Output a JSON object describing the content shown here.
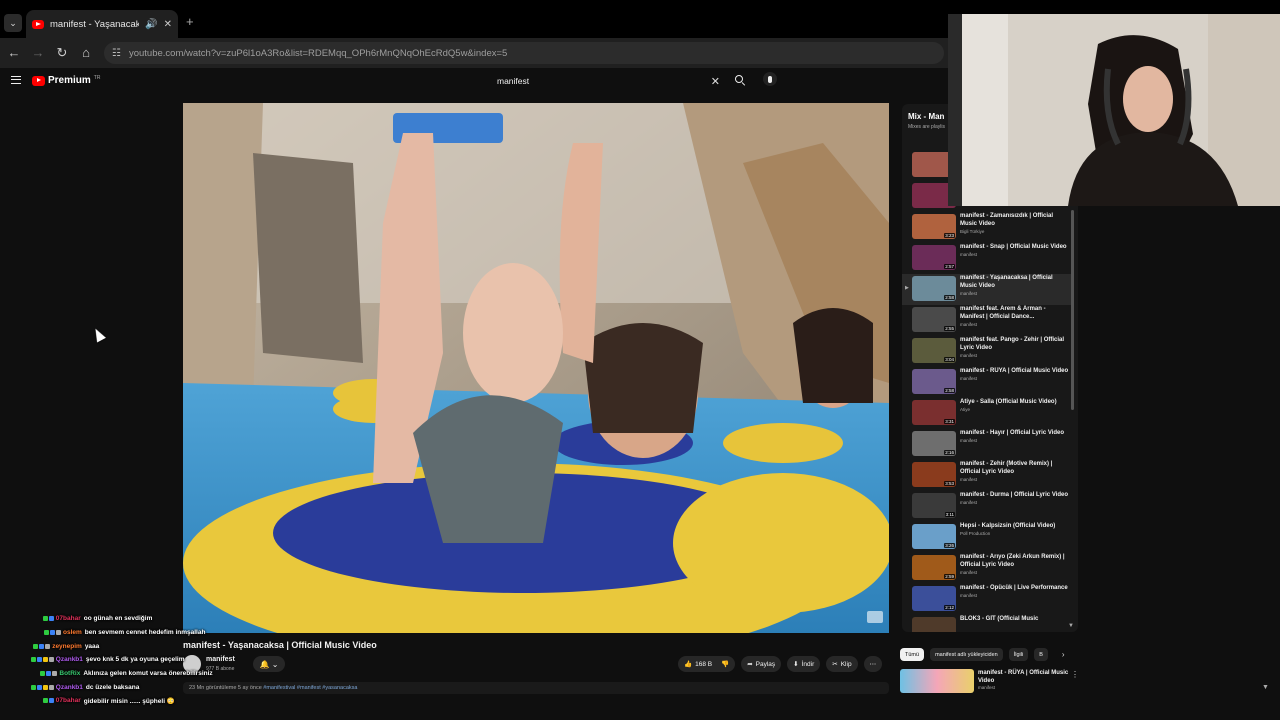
{
  "browser": {
    "tab_title": "manifest - Yaşanacaksa | Of",
    "new_tab": "+",
    "url": "youtube.com/watch?v=zuP6l1oA3Ro&list=RDEMqq_OPh6rMnQNqOhEcRdQ5w&index=5"
  },
  "header": {
    "logo_text": "Premium",
    "logo_tm": "TR",
    "search_value": "manifest",
    "clear_glyph": "✕"
  },
  "video": {
    "title": "manifest - Yaşanacaksa | Official Music Video",
    "channel": "manifest",
    "subscribers": "977 B abone",
    "bell_glyph": "🔔 ⌄",
    "likes": "168 B",
    "share": "Paylaş",
    "download": "İndir",
    "clip": "Klip",
    "more": "⋯",
    "desc_meta": "23 Mn görüntüleme  5 ay önce ",
    "desc_tags": "#manifestival #manifest #yasanacaksa"
  },
  "playlist": {
    "title": "Mix - Man",
    "subtitle": "Mixes are playlis",
    "items": [
      {
        "title": "",
        "channel": "",
        "duration": "",
        "thumb": "#a0574a"
      },
      {
        "title": "",
        "channel": "",
        "duration": "",
        "thumb": "#7a2a48"
      },
      {
        "title": "manifest - Zamanısızdık | Official Music Video",
        "channel": "Bigli Türkiye",
        "duration": "3:23",
        "thumb": "#b0623e"
      },
      {
        "title": "manifest - Snap | Official Music Video",
        "channel": "manifest",
        "duration": "2:57",
        "thumb": "#6b2c58"
      },
      {
        "title": "manifest - Yaşanacaksa | Official Music Video",
        "channel": "manifest",
        "duration": "2:58",
        "thumb": "#6c8b9a",
        "active": true
      },
      {
        "title": "manifest feat. Arem & Arman - Manifest | Official Dance...",
        "channel": "manifest",
        "duration": "2:55",
        "thumb": "#4a4a4a"
      },
      {
        "title": "manifest feat. Pango - Zehir | Official Lyric Video",
        "channel": "manifest",
        "duration": "3:04",
        "thumb": "#5b5b3c"
      },
      {
        "title": "manifest - RÜYA | Official Music Video",
        "channel": "manifest",
        "duration": "2:58",
        "thumb": "#6b5a8c"
      },
      {
        "title": "Atiye - Salla (Official Music Video)",
        "channel": "Atiye",
        "duration": "3:31",
        "thumb": "#7a2f2f"
      },
      {
        "title": "manifest - Hayır | Official Lyric Video",
        "channel": "manifest",
        "duration": "2:16",
        "thumb": "#6e6e6e"
      },
      {
        "title": "manifest - Zehir (Motive Remix) | Official Lyric Video",
        "channel": "manifest",
        "duration": "3:53",
        "thumb": "#8a3b1d"
      },
      {
        "title": "manifest - Durma | Official Lyric Video",
        "channel": "manifest",
        "duration": "3:11",
        "thumb": "#3a3a3a"
      },
      {
        "title": "Hepsi - Kalpsizsin (Official Video)",
        "channel": "Poll Production",
        "duration": "3:26",
        "thumb": "#6a9fc9"
      },
      {
        "title": "manifest - Arıyo (Zeki Arkun Remix) | Official Lyric Video",
        "channel": "manifest",
        "duration": "2:59",
        "thumb": "#a05a1a"
      },
      {
        "title": "manifest - Öpücük | Live Performance",
        "channel": "manifest",
        "duration": "2:12",
        "thumb": "#3b4f9a"
      },
      {
        "title": "BLOK3 - GİT (Official Music",
        "channel": "",
        "duration": "2:39",
        "thumb": "#4f3a2a"
      }
    ]
  },
  "chips": [
    "Tümü",
    "manifest adlı yükleyiciden",
    "İlgili",
    "B"
  ],
  "chip_next": "›",
  "recommendation": {
    "title": "manifest - RÜYA | Official Music Video",
    "channel": "manifest",
    "more": "⋮"
  },
  "chat": [
    {
      "user": "07bahar",
      "msg": "oo günah en sevdiğim",
      "color": "#e0305a",
      "badges": [
        "#2ecc40",
        "#3b82f6"
      ]
    },
    {
      "user": "oslem",
      "msg": "ben sevmem cennet hedefim inmşallah",
      "color": "#ff7a2f",
      "badges": [
        "#2ecc40",
        "#3b82f6",
        "#aaa"
      ]
    },
    {
      "user": "zeynepim",
      "msg": "yaaa",
      "color": "#ff7a2f",
      "badges": [
        "#2ecc40",
        "#3b82f6",
        "#aaa"
      ]
    },
    {
      "user": "Qzankb1",
      "msg": "şevo knk 5 dk ya oyuna geçelim",
      "color": "#b05cf0",
      "badges": [
        "#2ecc40",
        "#3b82f6",
        "#f1c40f",
        "#aaa"
      ]
    },
    {
      "user": "BotRix",
      "msg": "Aklınıza gelen komut varsa önerebilirsiniz",
      "color": "#38c96f",
      "badges": [
        "#2ecc40",
        "#3b82f6",
        "#aaa"
      ]
    },
    {
      "user": "Qzankb1",
      "msg": "dc üzele baksana",
      "color": "#b05cf0",
      "badges": [
        "#2ecc40",
        "#3b82f6",
        "#f1c40f",
        "#aaa"
      ]
    },
    {
      "user": "07bahar",
      "msg": "gidebilir misin ...... şüpheli 😳",
      "color": "#e0305a",
      "badges": [
        "#2ecc40",
        "#3b82f6"
      ]
    }
  ]
}
